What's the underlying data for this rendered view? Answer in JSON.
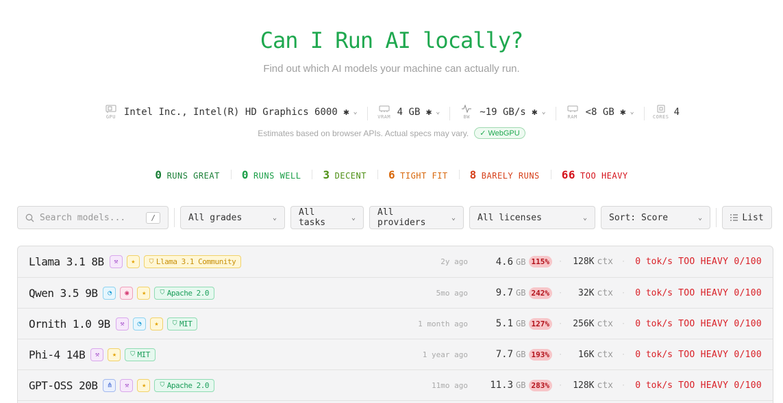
{
  "header": {
    "title": "Can I Run AI locally?",
    "subtitle": "Find out which AI models your machine can actually run."
  },
  "specs": [
    {
      "icon": "gpu-icon",
      "label": "GPU",
      "value": "Intel Inc., Intel(R) HD Graphics 6000 ✱"
    },
    {
      "icon": "vram-icon",
      "label": "VRAM",
      "value": "4 GB ✱"
    },
    {
      "icon": "bandwidth-icon",
      "label": "BW",
      "value": "~19 GB/s ✱"
    },
    {
      "icon": "ram-icon",
      "label": "RAM",
      "value": "<8 GB ✱"
    },
    {
      "icon": "cpu-icon",
      "label": "CORES",
      "value": "4"
    }
  ],
  "note": {
    "text": "Estimates based on browser APIs. Actual specs may vary.",
    "badge": "✓ WebGPU"
  },
  "counts": [
    {
      "n": "0",
      "label": "RUNS GREAT",
      "color": "#1a7f37"
    },
    {
      "n": "0",
      "label": "RUNS WELL",
      "color": "#1a9e47"
    },
    {
      "n": "3",
      "label": "DECENT",
      "color": "#4d8f14"
    },
    {
      "n": "6",
      "label": "TIGHT FIT",
      "color": "#d8670a"
    },
    {
      "n": "8",
      "label": "BARELY RUNS",
      "color": "#d6401a"
    },
    {
      "n": "66",
      "label": "TOO HEAVY",
      "color": "#d4121b"
    }
  ],
  "toolbar": {
    "search_placeholder": "Search models...",
    "search_shortcut": "/",
    "grades": "All grades",
    "tasks": "All tasks",
    "providers": "All providers",
    "licenses": "All licenses",
    "sort": "Sort: Score",
    "view": "List"
  },
  "models": [
    {
      "name": "Llama 3.1 8B",
      "tags": [
        "tool",
        "star"
      ],
      "license": "Llama 3.1 Community",
      "license_style": "y",
      "age": "2y ago",
      "size": "4.6",
      "size_unit": "GB",
      "pct": "115%",
      "ctx": "128K",
      "ctx_unit": "ctx",
      "tok": "0 tok/s",
      "grade": "TOO HEAVY 0/100"
    },
    {
      "name": "Qwen 3.5 9B",
      "tags": [
        "idea",
        "eye",
        "star"
      ],
      "license": "Apache 2.0",
      "license_style": "g",
      "age": "5mo ago",
      "size": "9.7",
      "size_unit": "GB",
      "pct": "242%",
      "ctx": "32K",
      "ctx_unit": "ctx",
      "tok": "0 tok/s",
      "grade": "TOO HEAVY 0/100"
    },
    {
      "name": "Ornith 1.0 9B",
      "tags": [
        "tool",
        "idea",
        "star"
      ],
      "license": "MIT",
      "license_style": "g",
      "age": "1 month ago",
      "size": "5.1",
      "size_unit": "GB",
      "pct": "127%",
      "ctx": "256K",
      "ctx_unit": "ctx",
      "tok": "0 tok/s",
      "grade": "TOO HEAVY 0/100"
    },
    {
      "name": "Phi-4 14B",
      "tags": [
        "tool",
        "star"
      ],
      "license": "MIT",
      "license_style": "g",
      "age": "1 year ago",
      "size": "7.7",
      "size_unit": "GB",
      "pct": "193%",
      "ctx": "16K",
      "ctx_unit": "ctx",
      "tok": "0 tok/s",
      "grade": "TOO HEAVY 0/100"
    },
    {
      "name": "GPT-OSS 20B",
      "tags": [
        "net",
        "tool",
        "star"
      ],
      "license": "Apache 2.0",
      "license_style": "g",
      "age": "11mo ago",
      "size": "11.3",
      "size_unit": "GB",
      "pct": "283%",
      "ctx": "128K",
      "ctx_unit": "ctx",
      "tok": "0 tok/s",
      "grade": "TOO HEAVY 0/100"
    }
  ]
}
